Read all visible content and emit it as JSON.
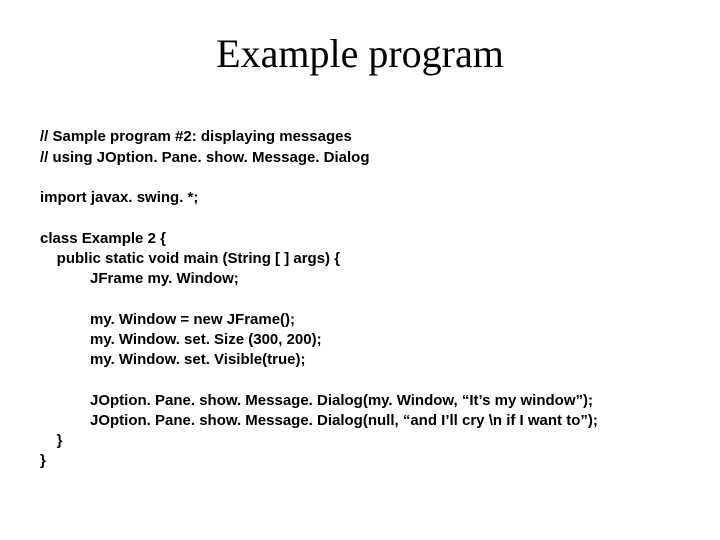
{
  "title": "Example program",
  "code": {
    "c1": "// Sample program #2: displaying messages",
    "c2": "// using JOption. Pane. show. Message. Dialog",
    "c3": "",
    "c4": "import javax. swing. *;",
    "c5": "",
    "c6": "class Example 2 {",
    "c7": "    public static void main (String [ ] args) {",
    "c8": "            JFrame my. Window;",
    "c9": "",
    "c10": "            my. Window = new JFrame();",
    "c11": "            my. Window. set. Size (300, 200);",
    "c12": "            my. Window. set. Visible(true);",
    "c13": "",
    "c14": "            JOption. Pane. show. Message. Dialog(my. Window, “It’s my window”);",
    "c15": "            JOption. Pane. show. Message. Dialog(null, “and I’ll cry \\n if I want to”);",
    "c16": "    }",
    "c17": "}"
  }
}
